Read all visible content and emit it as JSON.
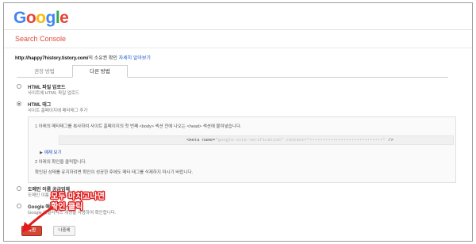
{
  "header": {
    "logo_letters": [
      "G",
      "o",
      "o",
      "g",
      "l",
      "e"
    ],
    "product_name": "Search Console"
  },
  "site": {
    "url": "http://happy7history.tistory.com/",
    "suffix": "의 소유권 확인",
    "link_label": "자세히 알아보기"
  },
  "tabs": [
    {
      "label": "권장 방법",
      "active": false
    },
    {
      "label": "다른 방법",
      "active": true
    }
  ],
  "options": [
    {
      "title": "HTML 파일 업로드",
      "subtitle": "사이트에 HTML 파일 업로드",
      "checked": false
    },
    {
      "title": "HTML 태그",
      "subtitle": "사이트 홈페이지에 메타태그 추가",
      "checked": true
    },
    {
      "title": "도메인 이름 공급업체",
      "subtitle": "도메인 이름 공급업체에 로그인합니다.",
      "checked": false
    },
    {
      "title": "Google 애널리틱스",
      "subtitle": "Google 애널리틱스 계정을 사용하여 확인합니다.",
      "checked": false
    }
  ],
  "instructions": {
    "step1": "1  아래의 메타태그를 복사하여 사이트 홈페이지의 첫 번째 <body> 섹션 전에 나오는 <head> 섹션에 붙여넣습니다.",
    "code_visible": "<meta name=",
    "code_blurred": "\"google-site-verification\" content=\"••••••••••••••••••••••••••••\"",
    "code_end": "/>",
    "show_example": "예제 보기",
    "step2": "2  아래의 확인을 클릭합니다.",
    "note": "확인된 상태를 유지하려면 확인이 성공한 후에도 메타 태그를 삭제하지 마시기 바랍니다."
  },
  "buttons": {
    "confirm": "확인",
    "later": "나중에"
  },
  "annotation": {
    "line1": "모두 마치고나면",
    "line2": "확인 클릭",
    "color": "#e21b1b"
  },
  "colors": {
    "accent_red": "#d14836",
    "link_blue": "#1a55c0"
  }
}
